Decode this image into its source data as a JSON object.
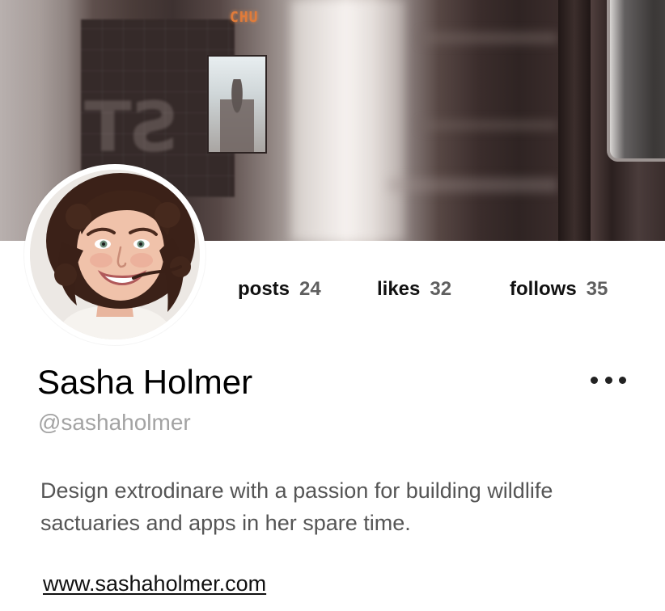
{
  "cover": {
    "sign_text": "CHU"
  },
  "profile": {
    "name": "Sasha Holmer",
    "handle": "@sashaholmer",
    "bio": "Design extrodinare with a passion for building wildlife sactuaries and apps in her spare time.",
    "website": "www.sashaholmer.com",
    "more_icon": "more-horizontal-icon"
  },
  "stats": {
    "posts": {
      "label": "posts",
      "value": "24"
    },
    "likes": {
      "label": "likes",
      "value": "32"
    },
    "follows": {
      "label": "follows",
      "value": "35"
    }
  }
}
